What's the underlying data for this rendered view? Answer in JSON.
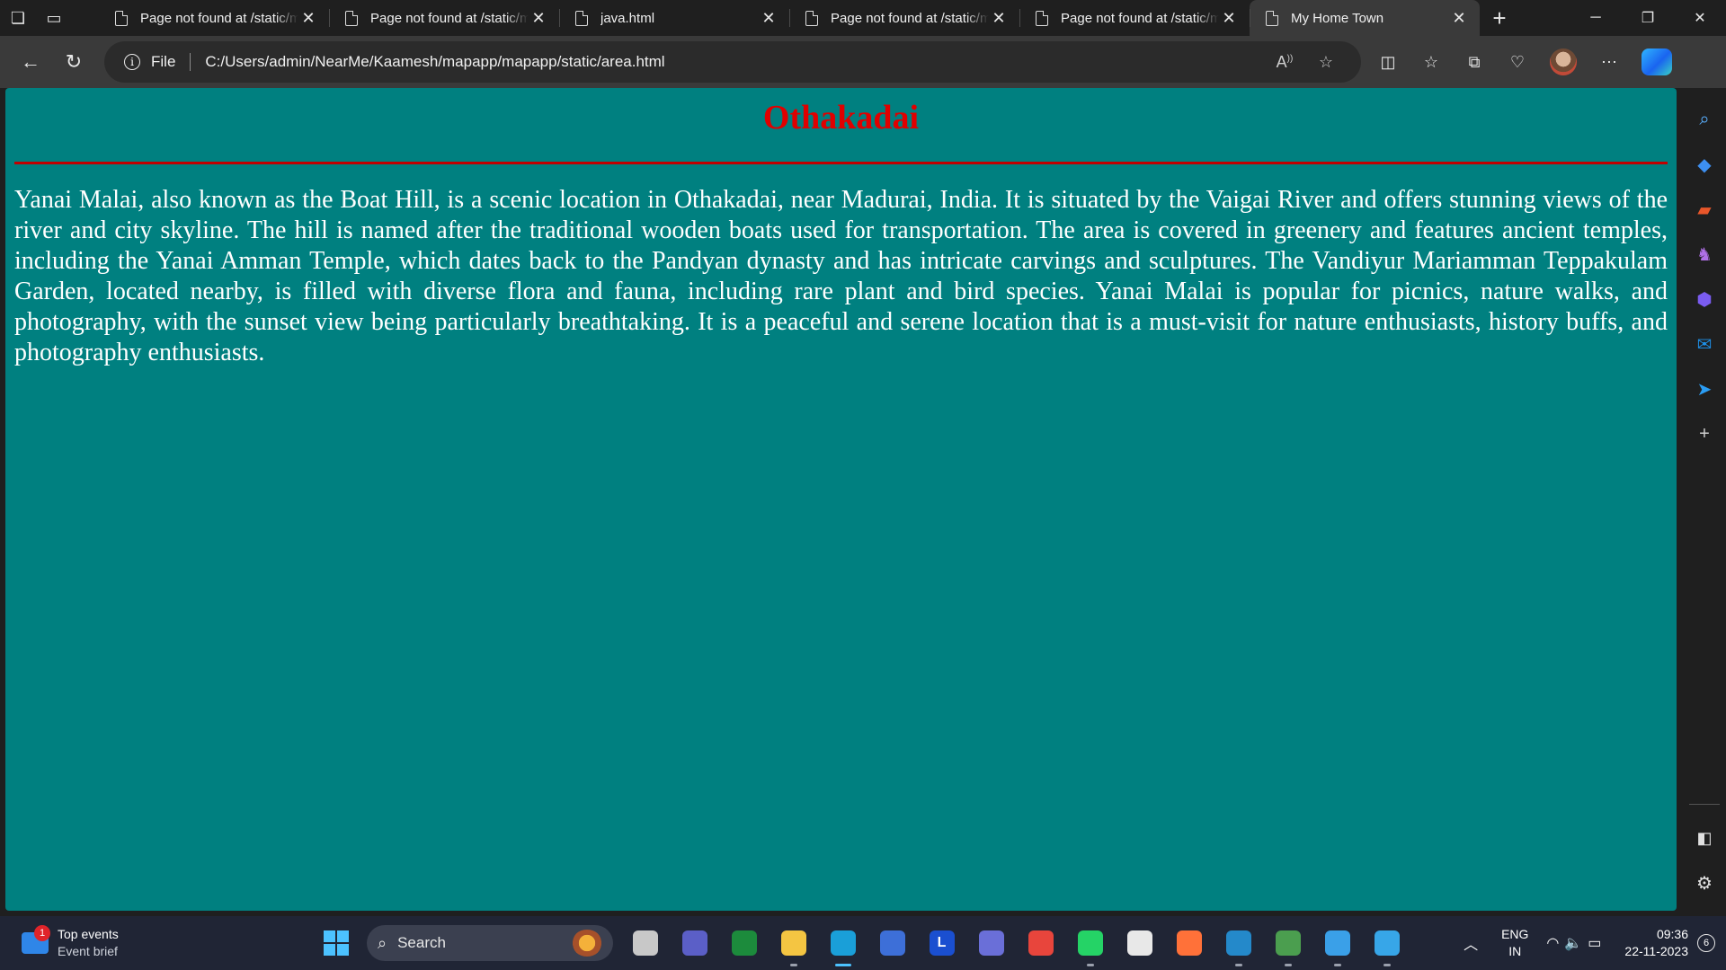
{
  "browser": {
    "tabs": [
      {
        "title": "Page not found at /static/m",
        "active": false
      },
      {
        "title": "Page not found at /static/m",
        "active": false
      },
      {
        "title": "java.html",
        "active": false
      },
      {
        "title": "Page not found at /static/m",
        "active": false
      },
      {
        "title": "Page not found at /static/m",
        "active": false
      },
      {
        "title": "My Home Town",
        "active": true
      }
    ],
    "address": {
      "scheme_label": "File",
      "url": "C:/Users/admin/NearMe/Kaamesh/mapapp/mapapp/static/area.html"
    },
    "omnibox_icons": [
      "read-aloud-icon",
      "favorite-star-icon"
    ],
    "toolbar_icons": [
      "split-screen-icon",
      "favorites-icon",
      "collections-icon",
      "browser-essentials-icon",
      "profile-avatar",
      "more-icon",
      "copilot-icon"
    ],
    "sidebar_icons": [
      "search-icon",
      "shopping-tag-icon",
      "tools-icon",
      "games-icon",
      "office-icon",
      "outlook-icon",
      "send-icon",
      "add-icon",
      "hide-sidebar-icon",
      "settings-icon"
    ]
  },
  "page": {
    "background_color": "#008080",
    "heading": "Othakadai",
    "heading_color": "#e00000",
    "rule_color": "#c00000",
    "paragraph": "Yanai Malai, also known as the Boat Hill, is a scenic location in Othakadai, near Madurai, India. It is situated by the Vaigai River and offers stunning views of the river and city skyline. The hill is named after the traditional wooden boats used for transportation. The area is covered in greenery and features ancient temples, including the Yanai Amman Temple, which dates back to the Pandyan dynasty and has intricate carvings and sculptures. The Vandiyur Mariamman Teppakulam Garden, located nearby, is filled with diverse flora and fauna, including rare plant and bird species. Yanai Malai is popular for picnics, nature walks, and photography, with the sunset view being particularly breathtaking. It is a peaceful and serene location that is a must-visit for nature enthusiasts, history buffs, and photography enthusiasts."
  },
  "taskbar": {
    "widget": {
      "title": "Top events",
      "subtitle": "Event brief",
      "badge": "1"
    },
    "search_placeholder": "Search",
    "apps": [
      {
        "name": "task-view-icon",
        "color": "#c8c8c8",
        "glyph": "",
        "active": false,
        "running": false
      },
      {
        "name": "teams-meet-icon",
        "color": "#5b5fc7",
        "glyph": "",
        "active": false,
        "running": false
      },
      {
        "name": "loop-icon",
        "color": "#1c8b3c",
        "glyph": "",
        "active": false,
        "running": false
      },
      {
        "name": "file-explorer-icon",
        "color": "#f4c542",
        "glyph": "",
        "active": false,
        "running": true
      },
      {
        "name": "edge-icon",
        "color": "#1a9fd8",
        "glyph": "",
        "active": true,
        "running": true
      },
      {
        "name": "store-icon",
        "color": "#3d6fd8",
        "glyph": "",
        "active": false,
        "running": false
      },
      {
        "name": "l-app-icon",
        "color": "#1a4fd0",
        "glyph": "L",
        "active": false,
        "running": false
      },
      {
        "name": "pen-app-icon",
        "color": "#6a6fd8",
        "glyph": "",
        "active": false,
        "running": false
      },
      {
        "name": "chrome-icon",
        "color": "#e8453c",
        "glyph": "",
        "active": false,
        "running": false
      },
      {
        "name": "whatsapp-icon",
        "color": "#25d366",
        "glyph": "",
        "active": false,
        "running": true
      },
      {
        "name": "document-app-icon",
        "color": "#e8e8e8",
        "glyph": "",
        "active": false,
        "running": false
      },
      {
        "name": "firefox-icon",
        "color": "#ff7139",
        "glyph": "",
        "active": false,
        "running": false
      },
      {
        "name": "vscode-icon",
        "color": "#2489ca",
        "glyph": "",
        "active": false,
        "running": true
      },
      {
        "name": "chrome-profile-icon",
        "color": "#4b9e4f",
        "glyph": "",
        "active": false,
        "running": true
      },
      {
        "name": "notepad-icon",
        "color": "#3aa0e8",
        "glyph": "",
        "active": false,
        "running": true
      },
      {
        "name": "photos-icon",
        "color": "#37a6e8",
        "glyph": "",
        "active": false,
        "running": true
      }
    ],
    "tray": {
      "lang_line1": "ENG",
      "lang_line2": "IN",
      "time": "09:36",
      "date": "22-11-2023",
      "notifications": "6"
    }
  }
}
